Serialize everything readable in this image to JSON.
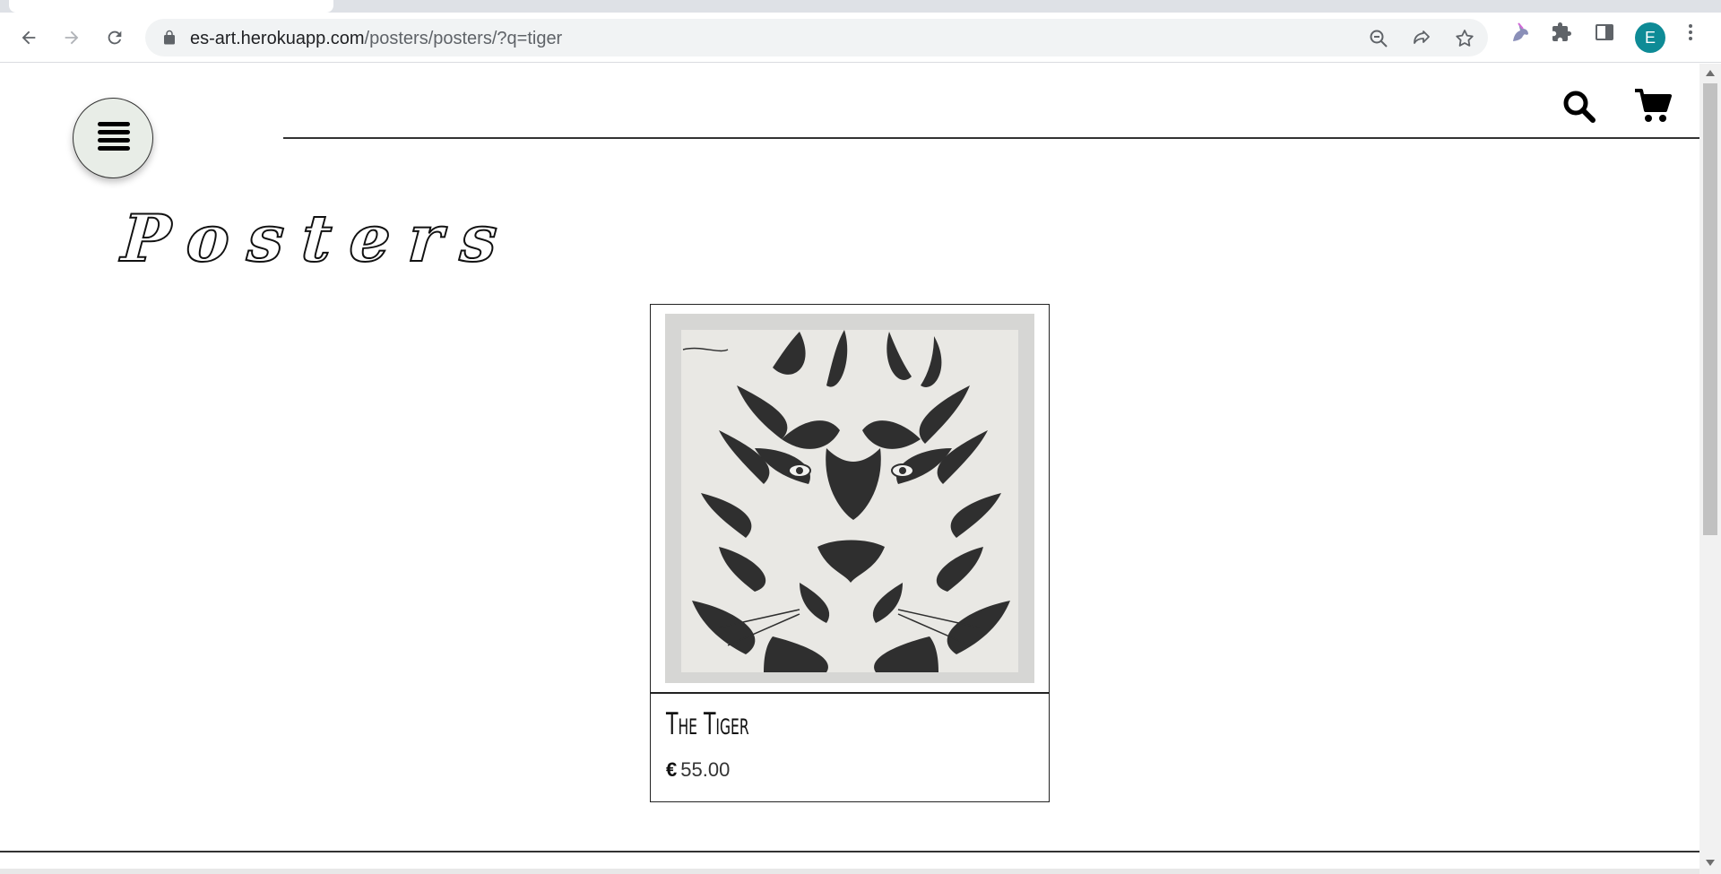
{
  "browser": {
    "url_host": "es-art.herokuapp.com",
    "url_path": "/posters/posters/?q=tiger",
    "profile_initial": "E",
    "icons": [
      "back-icon",
      "forward-icon",
      "reload-icon",
      "lock-icon",
      "zoom-out-icon",
      "share-icon",
      "bookmark-star-icon",
      "unicorn-extension-icon",
      "extensions-puzzle-icon",
      "side-panel-icon",
      "more-menu-icon"
    ]
  },
  "header": {
    "menu_icon": "hamburger-icon",
    "search_icon": "search-icon",
    "cart_icon": "cart-icon"
  },
  "page": {
    "title": "Posters"
  },
  "products": [
    {
      "title": "The Tiger",
      "currency": "€",
      "price": "55.00",
      "image": "tiger-poster-image"
    }
  ],
  "colors": {
    "menu_button_bg": "#e8ede7",
    "profile_bg": "#0e8b96"
  }
}
